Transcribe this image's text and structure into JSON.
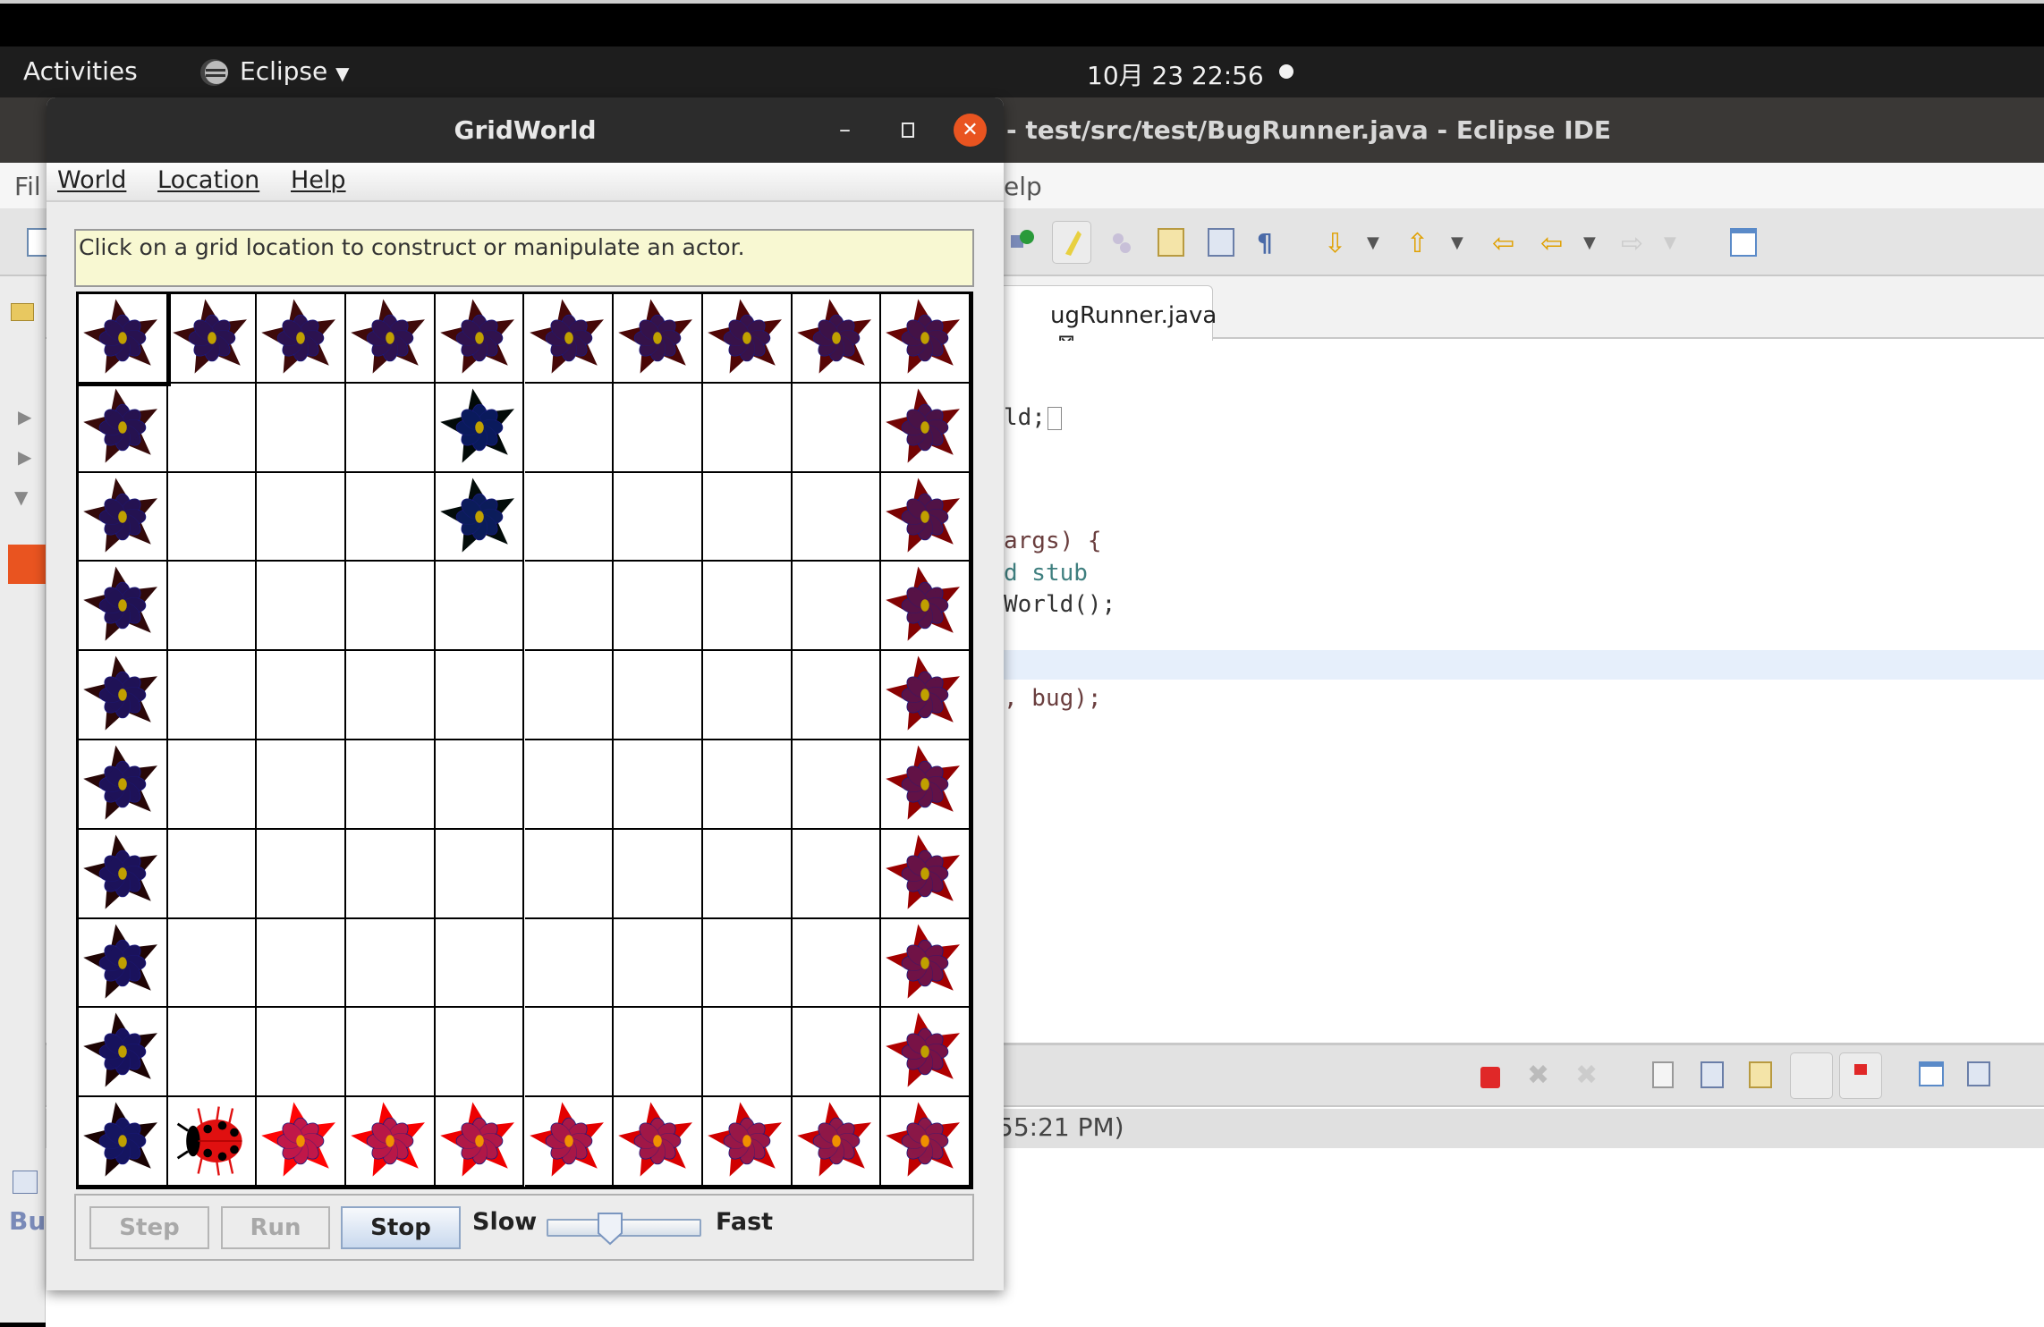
{
  "topbar": {
    "activities": "Activities",
    "app_name": "Eclipse",
    "clock": "10月 23 22:56"
  },
  "eclipse": {
    "title": "- test/src/test/BugRunner.java - Eclipse IDE",
    "menu_left": "Fil",
    "menu_right": "elp",
    "tab_label": "ugRunner.java",
    "code_lines": [
      "ld;",
      "args) {",
      "d stub",
      "World();",
      ", bug);"
    ],
    "status": "55:21 PM)",
    "left_panel_label": "Bu",
    "accent": "#e95420"
  },
  "gridworld": {
    "title": "GridWorld",
    "menu": [
      "World",
      "Location",
      "Help"
    ],
    "message": "Click on a grid location to construct or manipulate an actor.",
    "rows": 10,
    "cols": 10,
    "actors": [
      {
        "row": 0,
        "col": 0,
        "type": "flower",
        "petal": "#3a0a0a",
        "bloom": "#281250"
      },
      {
        "row": 0,
        "col": 1,
        "type": "flower",
        "petal": "#3c0a0a",
        "bloom": "#2a1250"
      },
      {
        "row": 0,
        "col": 2,
        "type": "flower",
        "petal": "#3e0a0a",
        "bloom": "#2c1250"
      },
      {
        "row": 0,
        "col": 3,
        "type": "flower",
        "petal": "#400a0a",
        "bloom": "#2e1250"
      },
      {
        "row": 0,
        "col": 4,
        "type": "flower",
        "petal": "#430808",
        "bloom": "#30124e"
      },
      {
        "row": 0,
        "col": 5,
        "type": "flower",
        "petal": "#460808",
        "bloom": "#32124c"
      },
      {
        "row": 0,
        "col": 6,
        "type": "flower",
        "petal": "#4a0606",
        "bloom": "#35124a"
      },
      {
        "row": 0,
        "col": 7,
        "type": "flower",
        "petal": "#500606",
        "bloom": "#38124a"
      },
      {
        "row": 0,
        "col": 8,
        "type": "flower",
        "petal": "#580505",
        "bloom": "#3c1248"
      },
      {
        "row": 0,
        "col": 9,
        "type": "flower",
        "petal": "#6a0505",
        "bloom": "#441246"
      },
      {
        "row": 1,
        "col": 0,
        "type": "flower",
        "petal": "#380a0a",
        "bloom": "#261250"
      },
      {
        "row": 2,
        "col": 0,
        "type": "flower",
        "petal": "#340a0a",
        "bloom": "#241252"
      },
      {
        "row": 3,
        "col": 0,
        "type": "flower",
        "petal": "#300909",
        "bloom": "#221254"
      },
      {
        "row": 4,
        "col": 0,
        "type": "flower",
        "petal": "#2c0808",
        "bloom": "#201256"
      },
      {
        "row": 5,
        "col": 0,
        "type": "flower",
        "petal": "#280707",
        "bloom": "#1e1258"
      },
      {
        "row": 6,
        "col": 0,
        "type": "flower",
        "petal": "#240606",
        "bloom": "#1c125a"
      },
      {
        "row": 7,
        "col": 0,
        "type": "flower",
        "petal": "#200505",
        "bloom": "#1a125c"
      },
      {
        "row": 8,
        "col": 0,
        "type": "flower",
        "petal": "#1d0404",
        "bloom": "#18125e"
      },
      {
        "row": 9,
        "col": 0,
        "type": "flower",
        "petal": "#1a0303",
        "bloom": "#151560"
      },
      {
        "row": 1,
        "col": 4,
        "type": "flower",
        "petal": "#020a08",
        "bloom": "#0a1a5c"
      },
      {
        "row": 2,
        "col": 4,
        "type": "flower",
        "petal": "#030c0a",
        "bloom": "#0c1c5a"
      },
      {
        "row": 1,
        "col": 9,
        "type": "flower",
        "petal": "#720404",
        "bloom": "#4a1246"
      },
      {
        "row": 2,
        "col": 9,
        "type": "flower",
        "petal": "#7a0303",
        "bloom": "#501246"
      },
      {
        "row": 3,
        "col": 9,
        "type": "flower",
        "petal": "#820202",
        "bloom": "#561246"
      },
      {
        "row": 4,
        "col": 9,
        "type": "flower",
        "petal": "#8a0202",
        "bloom": "#5c1246"
      },
      {
        "row": 5,
        "col": 9,
        "type": "flower",
        "petal": "#920101",
        "bloom": "#621246"
      },
      {
        "row": 6,
        "col": 9,
        "type": "flower",
        "petal": "#9a0000",
        "bloom": "#681246"
      },
      {
        "row": 7,
        "col": 9,
        "type": "flower",
        "petal": "#a40000",
        "bloom": "#701246"
      },
      {
        "row": 8,
        "col": 9,
        "type": "flower",
        "petal": "#b00000",
        "bloom": "#781246"
      },
      {
        "row": 9,
        "col": 1,
        "type": "bug",
        "color": "#e01010"
      },
      {
        "row": 9,
        "col": 2,
        "type": "flower",
        "petal": "#ff0505",
        "bloom": "#c0184a"
      },
      {
        "row": 9,
        "col": 3,
        "type": "flower",
        "petal": "#f80000",
        "bloom": "#b81848"
      },
      {
        "row": 9,
        "col": 4,
        "type": "flower",
        "petal": "#ee0000",
        "bloom": "#b01848"
      },
      {
        "row": 9,
        "col": 5,
        "type": "flower",
        "petal": "#e40000",
        "bloom": "#a81848"
      },
      {
        "row": 9,
        "col": 6,
        "type": "flower",
        "petal": "#da0000",
        "bloom": "#a01848"
      },
      {
        "row": 9,
        "col": 7,
        "type": "flower",
        "petal": "#d00000",
        "bloom": "#981848"
      },
      {
        "row": 9,
        "col": 8,
        "type": "flower",
        "petal": "#c80000",
        "bloom": "#901848"
      },
      {
        "row": 9,
        "col": 9,
        "type": "flower",
        "petal": "#c00000",
        "bloom": "#8a1848"
      }
    ],
    "controls": {
      "step": "Step",
      "run": "Run",
      "stop": "Stop",
      "slow": "Slow",
      "fast": "Fast",
      "speed": 0.38
    }
  }
}
